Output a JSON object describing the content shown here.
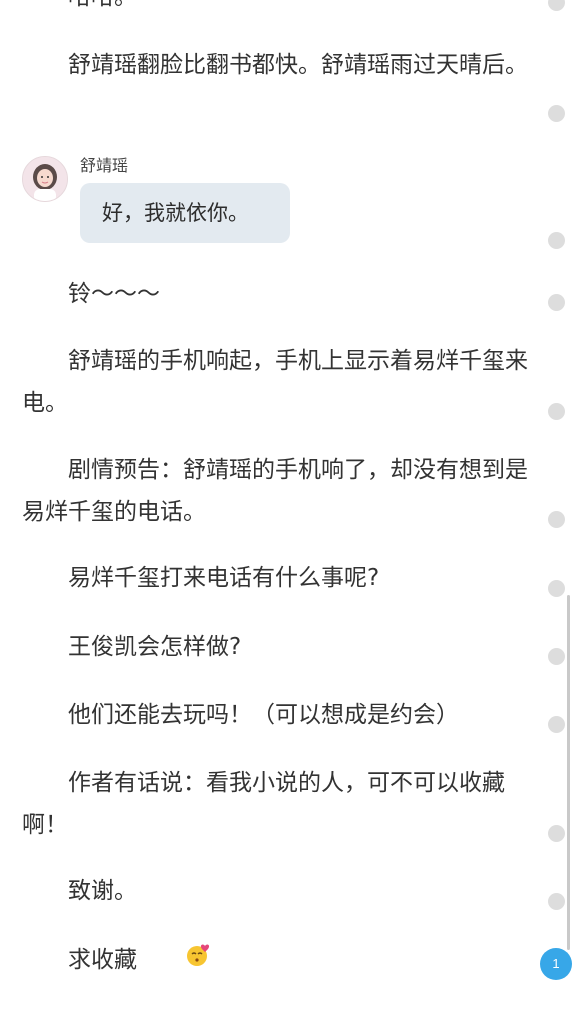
{
  "paragraphs": {
    "p0": "哈哈。",
    "p1": "舒靖瑶翻脸比翻书都快。舒靖瑶雨过天晴后。",
    "p2": "铃～～～",
    "p3": "舒靖瑶的手机响起，手机上显示着易烊千玺来电。",
    "p4": "剧情预告：舒靖瑶的手机响了，却没有想到是易烊千玺的电话。",
    "p5": "易烊千玺打来电话有什么事呢?",
    "p6": "王俊凯会怎样做?",
    "p7": "他们还能去玩吗！（可以想成是约会）",
    "p8": "作者有话说：看我小说的人，可不可以收藏啊！",
    "p9": "致谢。",
    "p10": "求收藏"
  },
  "chat": {
    "speaker": "舒靖瑶",
    "message": "好，我就依你。"
  },
  "comment_badge": {
    "count": "1"
  },
  "icons": {
    "emoji": "kissing-face-emoji",
    "avatar": "avatar-photo"
  }
}
